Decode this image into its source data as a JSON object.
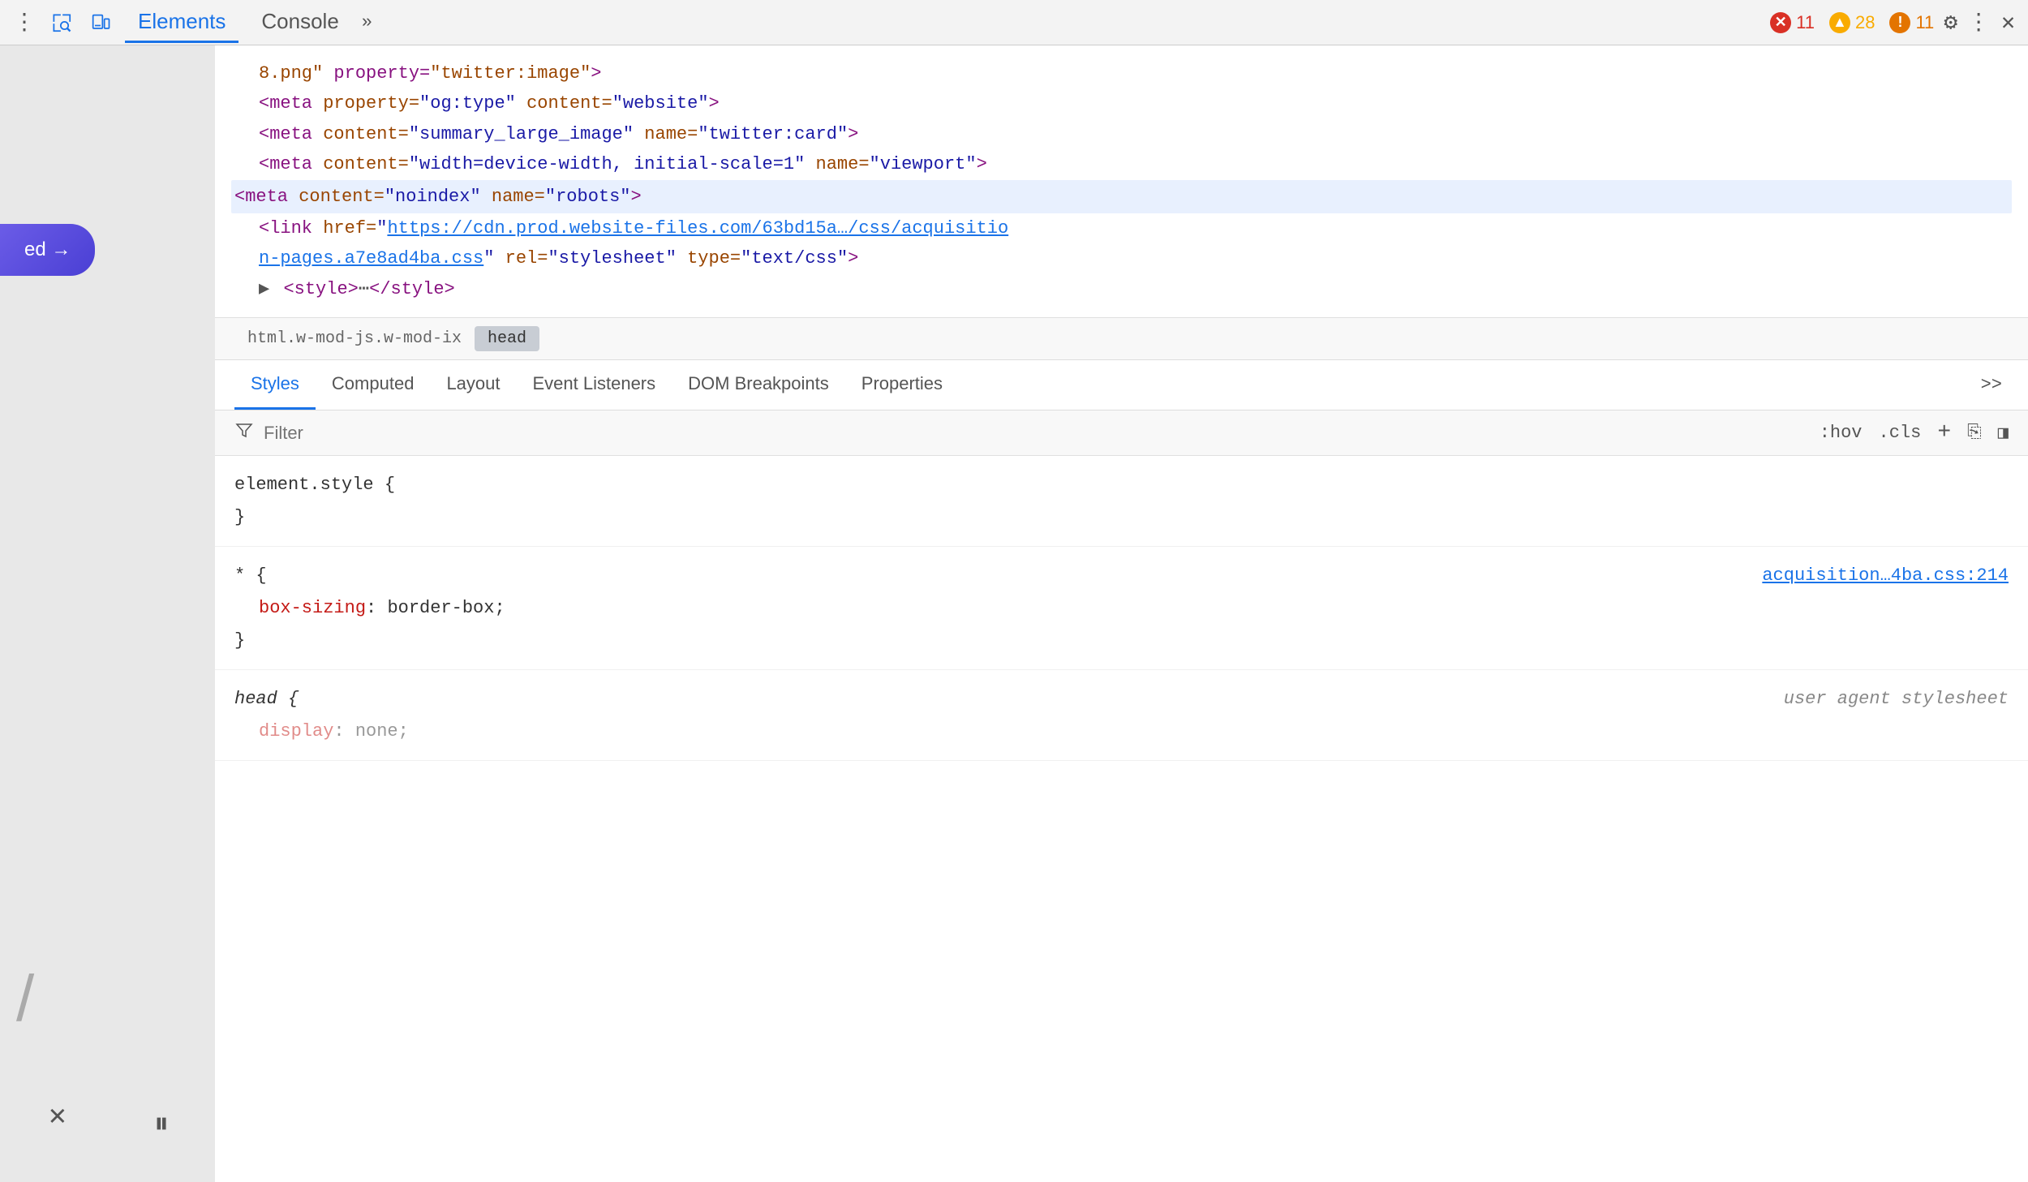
{
  "toolbar": {
    "dots_label": "⋮",
    "tabs": [
      {
        "id": "elements",
        "label": "Elements",
        "active": true
      },
      {
        "id": "console",
        "label": "Console",
        "active": false
      }
    ],
    "more_label": "»",
    "badges": {
      "error_count": "11",
      "warning_count": "28",
      "info_count": "11"
    },
    "gear_label": "⚙",
    "vert_dots_label": "⋮",
    "close_label": "✕"
  },
  "html_source": {
    "lines": [
      {
        "id": "line1",
        "indent": 1,
        "content": "8.png\" property=\"twitter:image\">"
      },
      {
        "id": "line2",
        "indent": 1,
        "content": "<meta property=\"og:type\" content=\"website\">"
      },
      {
        "id": "line3",
        "indent": 1,
        "content": "<meta content=\"summary_large_image\" name=\"twitter:card\">"
      },
      {
        "id": "line4",
        "indent": 1,
        "content": "<meta content=\"width=device-width, initial-scale=1\" name=\"viewport\">"
      },
      {
        "id": "line5",
        "indent": 1,
        "content": "<meta content=\"noindex\" name=\"robots\">",
        "highlighted": true
      },
      {
        "id": "line6",
        "indent": 1,
        "content": "<link href=\"https://cdn.prod.website-files.com/63bd15a…/css/acquisitio",
        "has_link": true
      },
      {
        "id": "line7",
        "indent": 1,
        "content": "n-pages.a7e8ad4ba.css\" rel=\"stylesheet\" type=\"text/css\">"
      },
      {
        "id": "line8",
        "indent": 1,
        "content": "▶ <style>⋯</style>"
      }
    ]
  },
  "breadcrumb": {
    "items": [
      {
        "id": "html",
        "label": "html.w-mod-js.w-mod-ix",
        "active": false
      },
      {
        "id": "head",
        "label": "head",
        "active": true
      }
    ]
  },
  "tabs": {
    "items": [
      {
        "id": "styles",
        "label": "Styles",
        "active": true
      },
      {
        "id": "computed",
        "label": "Computed",
        "active": false
      },
      {
        "id": "layout",
        "label": "Layout",
        "active": false
      },
      {
        "id": "event-listeners",
        "label": "Event Listeners",
        "active": false
      },
      {
        "id": "dom-breakpoints",
        "label": "DOM Breakpoints",
        "active": false
      },
      {
        "id": "properties",
        "label": "Properties",
        "active": false
      }
    ],
    "more_label": ">>"
  },
  "filter": {
    "placeholder": "Filter",
    "label": "Filter",
    "actions": {
      "hov_label": ":hov",
      "cls_label": ".cls",
      "plus_label": "+",
      "copy_label": "⎘",
      "sidebar_label": "◨"
    }
  },
  "style_rules": [
    {
      "id": "element-style",
      "selector": "element.style {",
      "properties": [],
      "close": "}",
      "source": ""
    },
    {
      "id": "star-rule",
      "selector": "* {",
      "properties": [
        {
          "prop": "box-sizing",
          "value": "border-box;"
        }
      ],
      "close": "}",
      "source": "acquisition…4ba.css:214"
    },
    {
      "id": "head-rule",
      "selector": "head {",
      "properties": [
        {
          "prop": "display",
          "value": "none;"
        }
      ],
      "close": "",
      "source": "user agent stylesheet",
      "source_italic": true
    }
  ],
  "preview": {
    "button_label": "ed →",
    "slash_label": "/",
    "x_label": "✕",
    "pause_label": "⏸"
  }
}
